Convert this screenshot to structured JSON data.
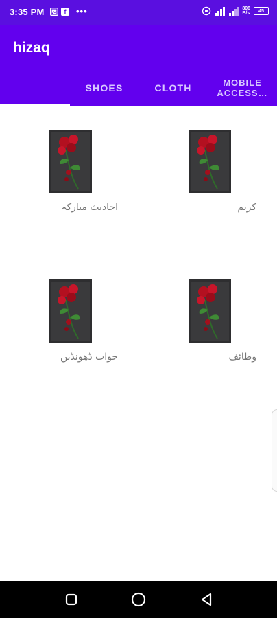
{
  "status_bar": {
    "time": "3:35 PM",
    "left_icons": [
      "gallery-icon",
      "facebook-icon"
    ],
    "more": "•••",
    "speed_value": "808",
    "speed_unit": "B/s",
    "battery": "45"
  },
  "app_bar": {
    "title": "hizaq",
    "background": "#6200ee"
  },
  "tabs": [
    {
      "label": "",
      "selected": true
    },
    {
      "label": "SHOES",
      "selected": false
    },
    {
      "label": "CLOTH",
      "selected": false
    },
    {
      "label_line1": "MOBILE",
      "label_line2": "ACCESS…",
      "selected": false
    }
  ],
  "items": [
    {
      "label": "کریم",
      "image": "red-rose-image"
    },
    {
      "label": "احادیث مبارکہ",
      "image": "red-rose-image"
    },
    {
      "label": "وظائف",
      "image": "red-rose-image"
    },
    {
      "label": "جواب ڈھونڈیں",
      "image": "red-rose-image"
    }
  ],
  "nav": {
    "buttons": [
      "recents-button",
      "home-button",
      "back-button"
    ]
  },
  "colors": {
    "status_bar": "#5a0fe0",
    "accent": "#6200ee",
    "label": "#777777"
  }
}
